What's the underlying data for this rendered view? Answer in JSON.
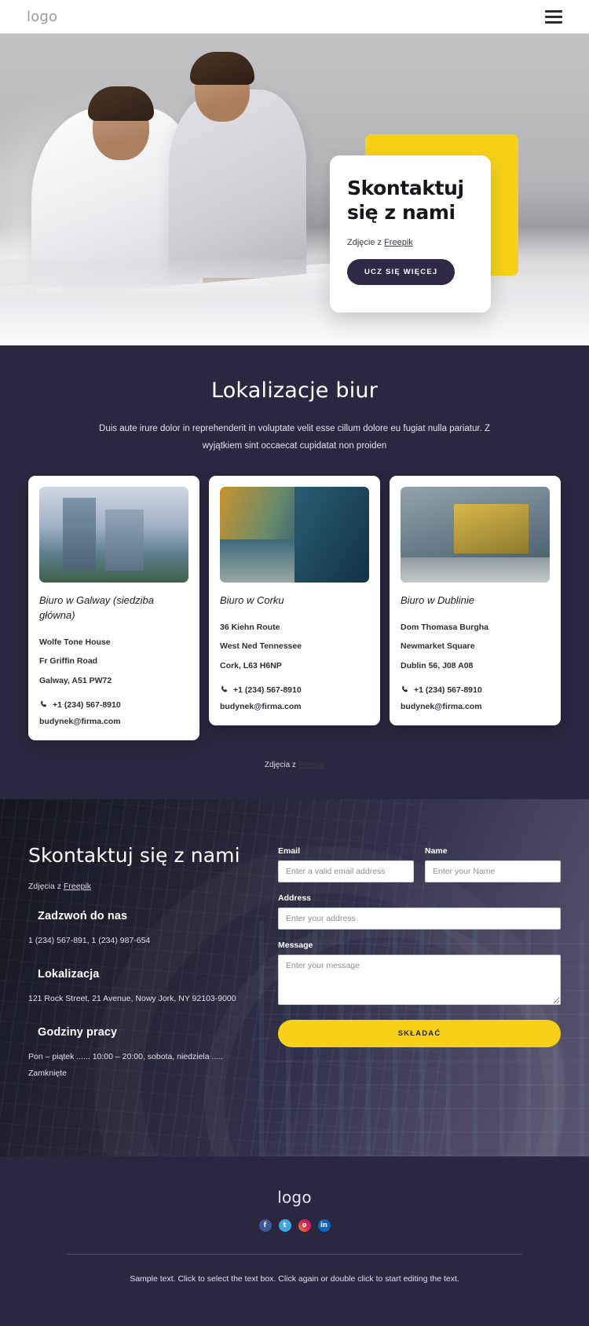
{
  "topbar": {
    "logo": "logo",
    "menu_icon": "hamburger-menu-icon"
  },
  "hero": {
    "title": "Skontaktuj się z nami",
    "credit_prefix": "Zdjęcie z ",
    "credit_link": "Freepik",
    "cta": "UCZ SIĘ WIĘCEJ"
  },
  "locations": {
    "title": "Lokalizacje biur",
    "subtitle": "Duis aute irure dolor in reprehenderit in voluptate velit esse cillum dolore eu fugiat nulla pariatur. Z wyjątkiem sint occaecat cupidatat non proiden",
    "credit_prefix": "Zdjęcia z ",
    "credit_link": "Freepik",
    "cards": [
      {
        "title": "Biuro w Galway (siedziba główna)",
        "address": [
          "Wolfe Tone House",
          "Fr Griffin Road",
          "Galway, A51 PW72"
        ],
        "phone": "+1 (234) 567-8910",
        "email": "budynek@firma.com"
      },
      {
        "title": "Biuro w Corku",
        "address": [
          "36 Kiehn Route",
          "West Ned Tennessee",
          "Cork, L63 H6NP"
        ],
        "phone": "+1 (234) 567-8910",
        "email": "budynek@firma.com"
      },
      {
        "title": "Biuro w Dublinie",
        "address": [
          "Dom Thomasa Burgha",
          "Newmarket Square",
          "Dublin 56, J08 A08"
        ],
        "phone": "+1 (234) 567-8910",
        "email": "budynek@firma.com"
      }
    ]
  },
  "contact": {
    "title": "Skontaktuj się z nami",
    "credit_prefix": "Zdjęcia z ",
    "credit_link": "Freepik",
    "blocks": [
      {
        "heading": "Zadzwoń do nas",
        "text": "1 (234) 567-891, 1 (234) 987-654"
      },
      {
        "heading": "Lokalizacja",
        "text": "121 Rock Street, 21 Avenue, Nowy Jork, NY 92103-9000"
      },
      {
        "heading": "Godziny pracy",
        "text": "Pon – piątek ...... 10:00 – 20:00, sobota, niedziela ..... Zamknięte"
      }
    ],
    "form": {
      "email_label": "Email",
      "email_placeholder": "Enter a valid email address",
      "name_label": "Name",
      "name_placeholder": "Enter your Name",
      "address_label": "Address",
      "address_placeholder": "Enter your address",
      "message_label": "Message",
      "message_placeholder": "Enter your message",
      "submit": "SKŁADAĆ"
    }
  },
  "footer": {
    "logo": "logo",
    "socials": [
      {
        "name": "facebook",
        "glyph": "f"
      },
      {
        "name": "twitter",
        "glyph": "t"
      },
      {
        "name": "instagram",
        "glyph": "o"
      },
      {
        "name": "linkedin",
        "glyph": "in"
      }
    ],
    "text": "Sample text. Click to select the text box. Click again or double click to start editing the text."
  },
  "colors": {
    "dark": "#2c2740",
    "yellow": "#f7d117",
    "white": "#ffffff"
  }
}
